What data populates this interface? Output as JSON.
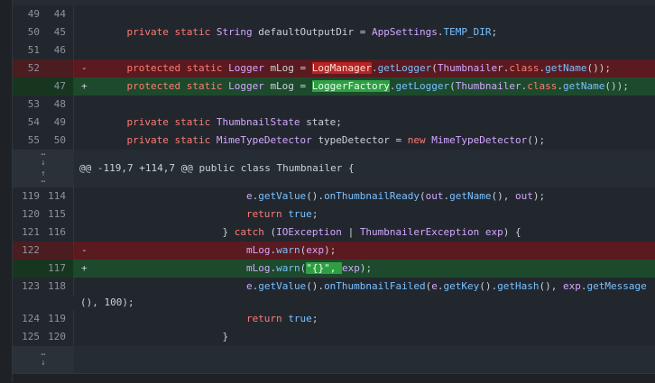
{
  "diff": {
    "rows": [
      {
        "old": "49",
        "new": "44",
        "kind": "ctx",
        "sign": "",
        "tokens": []
      },
      {
        "old": "50",
        "new": "45",
        "kind": "ctx",
        "sign": "",
        "tokens": [
          [
            "kw",
            "    private static "
          ],
          [
            "typ",
            "String "
          ],
          [
            "var",
            "defaultOutputDir = "
          ],
          [
            "typ",
            "AppSettings"
          ],
          [
            "var",
            "."
          ],
          [
            "fn",
            "TEMP_DIR"
          ],
          [
            "var",
            ";"
          ]
        ]
      },
      {
        "old": "51",
        "new": "46",
        "kind": "ctx",
        "sign": "",
        "tokens": []
      },
      {
        "old": "52",
        "new": "",
        "kind": "del",
        "sign": "-",
        "tokens": [
          [
            "kw",
            "    protected static "
          ],
          [
            "typ",
            "Logger "
          ],
          [
            "var",
            "mLog = "
          ],
          [
            "del-hl",
            "LogManager"
          ],
          [
            "var",
            "."
          ],
          [
            "fn",
            "getLogger"
          ],
          [
            "var",
            "("
          ],
          [
            "typ",
            "Thumbnailer"
          ],
          [
            "var",
            "."
          ],
          [
            "kw",
            "class"
          ],
          [
            "var",
            "."
          ],
          [
            "fn",
            "getName"
          ],
          [
            "var",
            "());"
          ]
        ]
      },
      {
        "old": "",
        "new": "47",
        "kind": "add",
        "sign": "+",
        "tokens": [
          [
            "kw",
            "    protected static "
          ],
          [
            "typ",
            "Logger "
          ],
          [
            "var",
            "mLog = "
          ],
          [
            "add-hl",
            "LoggerFactory"
          ],
          [
            "var",
            "."
          ],
          [
            "fn",
            "getLogger"
          ],
          [
            "var",
            "("
          ],
          [
            "typ",
            "Thumbnailer"
          ],
          [
            "var",
            "."
          ],
          [
            "kw",
            "class"
          ],
          [
            "var",
            "."
          ],
          [
            "fn",
            "getName"
          ],
          [
            "var",
            "());"
          ]
        ]
      },
      {
        "old": "53",
        "new": "48",
        "kind": "ctx",
        "sign": "",
        "tokens": []
      },
      {
        "old": "54",
        "new": "49",
        "kind": "ctx",
        "sign": "",
        "tokens": [
          [
            "kw",
            "    private static "
          ],
          [
            "typ",
            "ThumbnailState "
          ],
          [
            "var",
            "state;"
          ]
        ]
      },
      {
        "old": "55",
        "new": "50",
        "kind": "ctx",
        "sign": "",
        "tokens": [
          [
            "kw",
            "    private static "
          ],
          [
            "typ",
            "MimeTypeDetector "
          ],
          [
            "var",
            "typeDetector = "
          ],
          [
            "kw",
            "new "
          ],
          [
            "typ",
            "MimeTypeDetector"
          ],
          [
            "var",
            "();"
          ]
        ]
      }
    ],
    "hunk_header": "@@ -119,7 +114,7 @@ public class Thumbnailer {",
    "rows2": [
      {
        "old": "119",
        "new": "114",
        "kind": "ctx",
        "sign": "",
        "tokens": [
          [
            "var",
            "                        "
          ],
          [
            "typ",
            "e"
          ],
          [
            "var",
            "."
          ],
          [
            "fn",
            "getValue"
          ],
          [
            "var",
            "()."
          ],
          [
            "fn",
            "onThumbnailReady"
          ],
          [
            "var",
            "("
          ],
          [
            "typ",
            "out"
          ],
          [
            "var",
            "."
          ],
          [
            "fn",
            "getName"
          ],
          [
            "var",
            "(), "
          ],
          [
            "typ",
            "out"
          ],
          [
            "var",
            ");"
          ]
        ]
      },
      {
        "old": "120",
        "new": "115",
        "kind": "ctx",
        "sign": "",
        "tokens": [
          [
            "kw",
            "                        return "
          ],
          [
            "fn",
            "true"
          ],
          [
            "var",
            ";"
          ]
        ]
      },
      {
        "old": "121",
        "new": "116",
        "kind": "ctx",
        "sign": "",
        "tokens": [
          [
            "var",
            "                    } "
          ],
          [
            "kw",
            "catch "
          ],
          [
            "var",
            "("
          ],
          [
            "typ",
            "IOException "
          ],
          [
            "var",
            "| "
          ],
          [
            "typ",
            "ThumbnailerException "
          ],
          [
            "typ",
            "exp"
          ],
          [
            "var",
            ") {"
          ]
        ]
      },
      {
        "old": "122",
        "new": "",
        "kind": "del",
        "sign": "-",
        "tokens": [
          [
            "var",
            "                        "
          ],
          [
            "typ",
            "mLog"
          ],
          [
            "var",
            "."
          ],
          [
            "fn",
            "warn"
          ],
          [
            "var",
            "("
          ],
          [
            "typ",
            "exp"
          ],
          [
            "var",
            ");"
          ]
        ]
      },
      {
        "old": "",
        "new": "117",
        "kind": "add",
        "sign": "+",
        "tokens": [
          [
            "var",
            "                        "
          ],
          [
            "typ",
            "mLog"
          ],
          [
            "var",
            "."
          ],
          [
            "fn",
            "warn"
          ],
          [
            "var",
            "("
          ],
          [
            "add-hl",
            "\"{}\", "
          ],
          [
            "typ",
            "exp"
          ],
          [
            "var",
            ");"
          ]
        ]
      },
      {
        "old": "123",
        "new": "118",
        "kind": "ctx",
        "sign": "",
        "tokens": [
          [
            "var",
            "                        "
          ],
          [
            "typ",
            "e"
          ],
          [
            "var",
            "."
          ],
          [
            "fn",
            "getValue"
          ],
          [
            "var",
            "()."
          ],
          [
            "fn",
            "onThumbnailFailed"
          ],
          [
            "var",
            "("
          ],
          [
            "typ",
            "e"
          ],
          [
            "var",
            "."
          ],
          [
            "fn",
            "getKey"
          ],
          [
            "var",
            "()."
          ],
          [
            "fn",
            "getHash"
          ],
          [
            "var",
            "(), "
          ],
          [
            "typ",
            "exp"
          ],
          [
            "var",
            "."
          ],
          [
            "fn",
            "getMessage"
          ]
        ]
      },
      {
        "old": "124",
        "new": "119",
        "kind": "ctx",
        "sign": "",
        "tokens": [
          [
            "kw",
            "                        return "
          ],
          [
            "fn",
            "true"
          ],
          [
            "var",
            ";"
          ]
        ]
      },
      {
        "old": "125",
        "new": "120",
        "kind": "ctx",
        "sign": "",
        "tokens": [
          [
            "var",
            "                    }"
          ]
        ]
      }
    ],
    "wrap_text": "(), 100);"
  }
}
